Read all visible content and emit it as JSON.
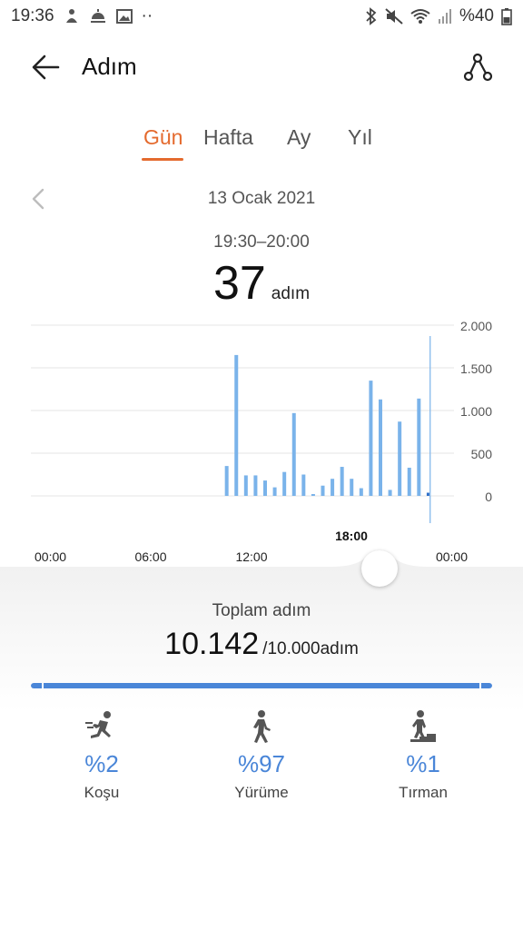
{
  "status_bar": {
    "time": "19:36",
    "dots": "··",
    "battery": "%40"
  },
  "app_bar": {
    "title": "Adım"
  },
  "tabs": [
    {
      "label": "Gün",
      "active": true
    },
    {
      "label": "Hafta",
      "active": false
    },
    {
      "label": "Ay",
      "active": false
    },
    {
      "label": "Yıl",
      "active": false
    }
  ],
  "date": "13 Ocak 2021",
  "selection": {
    "time_range": "19:30–20:00",
    "value": "37",
    "unit": "adım"
  },
  "chart_data": {
    "type": "bar",
    "x_unit": "hour",
    "xlim": [
      0,
      24
    ],
    "ylim": [
      0,
      2000
    ],
    "y_ticks": [
      0,
      500,
      1000,
      1500,
      2000
    ],
    "y_tick_labels": [
      "0",
      "500",
      "1.000",
      "1.500",
      "2.000"
    ],
    "x_tick_labels": [
      {
        "hour": 0,
        "label": "00:00"
      },
      {
        "hour": 6,
        "label": "06:00"
      },
      {
        "hour": 12,
        "label": "12:00"
      },
      {
        "hour": 18,
        "label": "18:00",
        "bold": true
      },
      {
        "hour": 24,
        "label": "00:00"
      }
    ],
    "bar_color": "#7ab3ea",
    "selected_hour": 19.5,
    "bars": [
      {
        "x": 10.0,
        "y": 350
      },
      {
        "x": 10.5,
        "y": 1650
      },
      {
        "x": 11.0,
        "y": 240
      },
      {
        "x": 11.5,
        "y": 240
      },
      {
        "x": 12.0,
        "y": 180
      },
      {
        "x": 12.5,
        "y": 100
      },
      {
        "x": 13.0,
        "y": 280
      },
      {
        "x": 13.5,
        "y": 970
      },
      {
        "x": 14.0,
        "y": 250
      },
      {
        "x": 14.5,
        "y": 20
      },
      {
        "x": 15.0,
        "y": 120
      },
      {
        "x": 15.5,
        "y": 200
      },
      {
        "x": 16.0,
        "y": 340
      },
      {
        "x": 16.5,
        "y": 200
      },
      {
        "x": 17.0,
        "y": 90
      },
      {
        "x": 17.5,
        "y": 1350
      },
      {
        "x": 18.0,
        "y": 1130
      },
      {
        "x": 18.5,
        "y": 70
      },
      {
        "x": 19.0,
        "y": 870
      },
      {
        "x": 19.5,
        "y": 330
      },
      {
        "x": 20.0,
        "y": 1140
      },
      {
        "x": 20.5,
        "y": 37
      }
    ]
  },
  "summary": {
    "label": "Toplam adım",
    "value": "10.142",
    "goal": "/10.000adım",
    "progress_fraction": 1.0
  },
  "activities": [
    {
      "name": "Koşu",
      "percent": "%2",
      "icon": "running-icon"
    },
    {
      "name": "Yürüme",
      "percent": "%97",
      "icon": "walking-icon"
    },
    {
      "name": "Tırman",
      "percent": "%1",
      "icon": "climbing-icon"
    }
  ],
  "colors": {
    "accent": "#e46a2e",
    "bar": "#7ab3ea",
    "progress": "#4a86d8"
  }
}
